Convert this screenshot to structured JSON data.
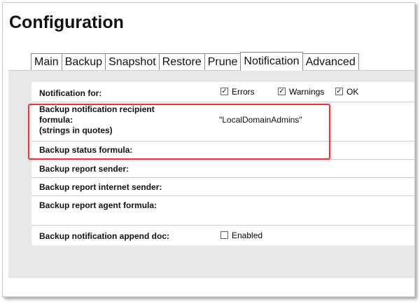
{
  "page": {
    "title": "Configuration"
  },
  "tabs": [
    {
      "label": "Main",
      "active": false
    },
    {
      "label": "Backup",
      "active": false
    },
    {
      "label": "Snapshot",
      "active": false
    },
    {
      "label": "Restore",
      "active": false
    },
    {
      "label": "Prune",
      "active": false
    },
    {
      "label": "Notification",
      "active": true
    },
    {
      "label": "Advanced",
      "active": false
    }
  ],
  "form": {
    "notification_for": {
      "label": "Notification for:",
      "options": [
        {
          "label": "Errors",
          "checked": true
        },
        {
          "label": "Warnings",
          "checked": true
        },
        {
          "label": "OK",
          "checked": true
        }
      ]
    },
    "recipient_formula": {
      "label_line1": "Backup notification recipient",
      "label_line2": "formula:",
      "label_line3": "(strings in quotes)",
      "value": "\"LocalDomainAdmins\""
    },
    "status_formula": {
      "label": "Backup status formula:",
      "value": ""
    },
    "report_sender": {
      "label": "Backup report sender:",
      "value": ""
    },
    "report_internet_sender": {
      "label": "Backup report internet sender:",
      "value": ""
    },
    "report_agent_formula": {
      "label": "Backup report agent formula:",
      "value": ""
    },
    "append_doc": {
      "label": "Backup notification append doc:",
      "option": {
        "label": "Enabled",
        "checked": false
      }
    }
  },
  "checkbox_glyph": "✓",
  "colors": {
    "highlight": "#e0393a",
    "panel_bg": "#e8e8e8"
  }
}
